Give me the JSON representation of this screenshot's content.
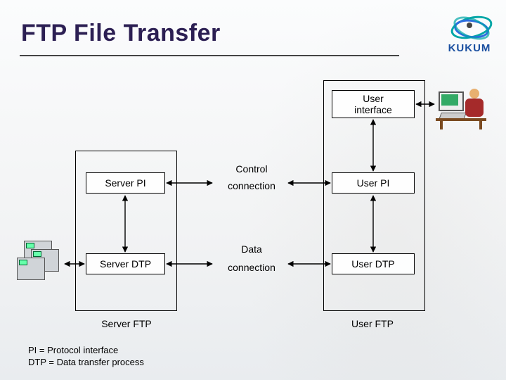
{
  "title": "FTP File Transfer",
  "logo_text": "KUKUM",
  "boxes": {
    "user_interface": "User\ninterface",
    "server_pi": "Server PI",
    "user_pi": "User PI",
    "server_dtp": "Server DTP",
    "user_dtp": "User DTP"
  },
  "connections": {
    "control_line1": "Control",
    "control_line2": "connection",
    "data_line1": "Data",
    "data_line2": "connection"
  },
  "captions": {
    "server_ftp": "Server FTP",
    "user_ftp": "User FTP"
  },
  "legend": {
    "pi": "PI = Protocol interface",
    "dtp": "DTP = Data transfer process"
  }
}
